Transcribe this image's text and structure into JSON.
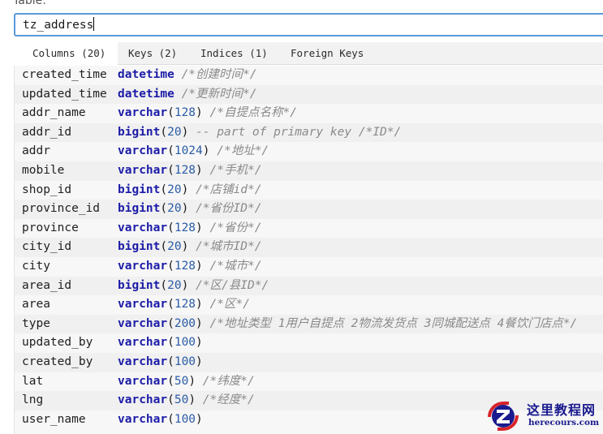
{
  "form": {
    "table_label": "Table:",
    "table_name": "tz_address"
  },
  "tabs": [
    {
      "label": "Columns (20)",
      "active": true
    },
    {
      "label": "Keys (2)",
      "active": false
    },
    {
      "label": "Indices (1)",
      "active": false
    },
    {
      "label": "Foreign Keys",
      "active": false
    }
  ],
  "columns": [
    {
      "name": "created_time",
      "type": "datetime",
      "len": "",
      "comment": "/*创建时间*/"
    },
    {
      "name": "updated_time",
      "type": "datetime",
      "len": "",
      "comment": "/*更新时间*/"
    },
    {
      "name": "addr_name",
      "type": "varchar",
      "len": "128",
      "comment": "/*自提点名称*/"
    },
    {
      "name": "addr_id",
      "type": "bigint",
      "len": "20",
      "comment": "-- part of primary key /*ID*/"
    },
    {
      "name": "addr",
      "type": "varchar",
      "len": "1024",
      "comment": "/*地址*/"
    },
    {
      "name": "mobile",
      "type": "varchar",
      "len": "128",
      "comment": "/*手机*/"
    },
    {
      "name": "shop_id",
      "type": "bigint",
      "len": "20",
      "comment": "/*店铺id*/"
    },
    {
      "name": "province_id",
      "type": "bigint",
      "len": "20",
      "comment": "/*省份ID*/"
    },
    {
      "name": "province",
      "type": "varchar",
      "len": "128",
      "comment": "/*省份*/"
    },
    {
      "name": "city_id",
      "type": "bigint",
      "len": "20",
      "comment": "/*城市ID*/"
    },
    {
      "name": "city",
      "type": "varchar",
      "len": "128",
      "comment": "/*城市*/"
    },
    {
      "name": "area_id",
      "type": "bigint",
      "len": "20",
      "comment": "/*区/县ID*/"
    },
    {
      "name": "area",
      "type": "varchar",
      "len": "128",
      "comment": "/*区*/"
    },
    {
      "name": "type",
      "type": "varchar",
      "len": "200",
      "comment": "/*地址类型 1用户自提点 2物流发货点 3同城配送点 4餐饮门店点*/"
    },
    {
      "name": "updated_by",
      "type": "varchar",
      "len": "100",
      "comment": ""
    },
    {
      "name": "created_by",
      "type": "varchar",
      "len": "100",
      "comment": ""
    },
    {
      "name": "lat",
      "type": "varchar",
      "len": "50",
      "comment": "/*纬度*/"
    },
    {
      "name": "lng",
      "type": "varchar",
      "len": "50",
      "comment": "/*经度*/"
    },
    {
      "name": "user_name",
      "type": "varchar",
      "len": "100",
      "comment": ""
    }
  ],
  "watermark": {
    "title": "这里教程网",
    "site": "herecours.com",
    "colors": {
      "red": "#d8232a",
      "blue": "#1b1b8f"
    }
  }
}
